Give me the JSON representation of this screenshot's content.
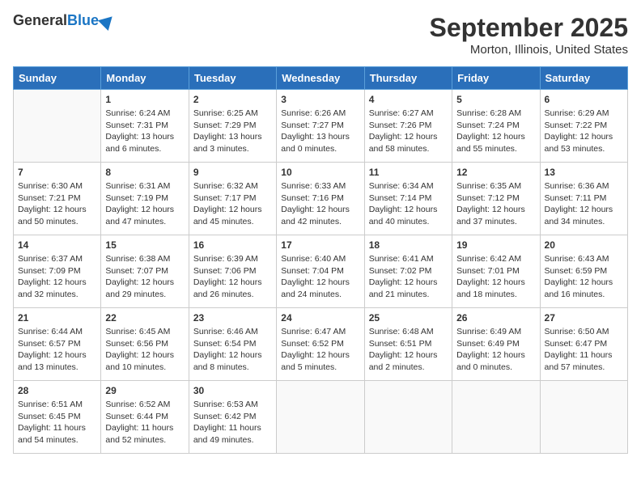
{
  "header": {
    "logo_general": "General",
    "logo_blue": "Blue",
    "month_title": "September 2025",
    "location": "Morton, Illinois, United States"
  },
  "weekdays": [
    "Sunday",
    "Monday",
    "Tuesday",
    "Wednesday",
    "Thursday",
    "Friday",
    "Saturday"
  ],
  "weeks": [
    [
      {
        "day": "",
        "sunrise": "",
        "sunset": "",
        "daylight": ""
      },
      {
        "day": "1",
        "sunrise": "6:24 AM",
        "sunset": "7:31 PM",
        "daylight": "13 hours and 6 minutes."
      },
      {
        "day": "2",
        "sunrise": "6:25 AM",
        "sunset": "7:29 PM",
        "daylight": "13 hours and 3 minutes."
      },
      {
        "day": "3",
        "sunrise": "6:26 AM",
        "sunset": "7:27 PM",
        "daylight": "13 hours and 0 minutes."
      },
      {
        "day": "4",
        "sunrise": "6:27 AM",
        "sunset": "7:26 PM",
        "daylight": "12 hours and 58 minutes."
      },
      {
        "day": "5",
        "sunrise": "6:28 AM",
        "sunset": "7:24 PM",
        "daylight": "12 hours and 55 minutes."
      },
      {
        "day": "6",
        "sunrise": "6:29 AM",
        "sunset": "7:22 PM",
        "daylight": "12 hours and 53 minutes."
      }
    ],
    [
      {
        "day": "7",
        "sunrise": "6:30 AM",
        "sunset": "7:21 PM",
        "daylight": "12 hours and 50 minutes."
      },
      {
        "day": "8",
        "sunrise": "6:31 AM",
        "sunset": "7:19 PM",
        "daylight": "12 hours and 47 minutes."
      },
      {
        "day": "9",
        "sunrise": "6:32 AM",
        "sunset": "7:17 PM",
        "daylight": "12 hours and 45 minutes."
      },
      {
        "day": "10",
        "sunrise": "6:33 AM",
        "sunset": "7:16 PM",
        "daylight": "12 hours and 42 minutes."
      },
      {
        "day": "11",
        "sunrise": "6:34 AM",
        "sunset": "7:14 PM",
        "daylight": "12 hours and 40 minutes."
      },
      {
        "day": "12",
        "sunrise": "6:35 AM",
        "sunset": "7:12 PM",
        "daylight": "12 hours and 37 minutes."
      },
      {
        "day": "13",
        "sunrise": "6:36 AM",
        "sunset": "7:11 PM",
        "daylight": "12 hours and 34 minutes."
      }
    ],
    [
      {
        "day": "14",
        "sunrise": "6:37 AM",
        "sunset": "7:09 PM",
        "daylight": "12 hours and 32 minutes."
      },
      {
        "day": "15",
        "sunrise": "6:38 AM",
        "sunset": "7:07 PM",
        "daylight": "12 hours and 29 minutes."
      },
      {
        "day": "16",
        "sunrise": "6:39 AM",
        "sunset": "7:06 PM",
        "daylight": "12 hours and 26 minutes."
      },
      {
        "day": "17",
        "sunrise": "6:40 AM",
        "sunset": "7:04 PM",
        "daylight": "12 hours and 24 minutes."
      },
      {
        "day": "18",
        "sunrise": "6:41 AM",
        "sunset": "7:02 PM",
        "daylight": "12 hours and 21 minutes."
      },
      {
        "day": "19",
        "sunrise": "6:42 AM",
        "sunset": "7:01 PM",
        "daylight": "12 hours and 18 minutes."
      },
      {
        "day": "20",
        "sunrise": "6:43 AM",
        "sunset": "6:59 PM",
        "daylight": "12 hours and 16 minutes."
      }
    ],
    [
      {
        "day": "21",
        "sunrise": "6:44 AM",
        "sunset": "6:57 PM",
        "daylight": "12 hours and 13 minutes."
      },
      {
        "day": "22",
        "sunrise": "6:45 AM",
        "sunset": "6:56 PM",
        "daylight": "12 hours and 10 minutes."
      },
      {
        "day": "23",
        "sunrise": "6:46 AM",
        "sunset": "6:54 PM",
        "daylight": "12 hours and 8 minutes."
      },
      {
        "day": "24",
        "sunrise": "6:47 AM",
        "sunset": "6:52 PM",
        "daylight": "12 hours and 5 minutes."
      },
      {
        "day": "25",
        "sunrise": "6:48 AM",
        "sunset": "6:51 PM",
        "daylight": "12 hours and 2 minutes."
      },
      {
        "day": "26",
        "sunrise": "6:49 AM",
        "sunset": "6:49 PM",
        "daylight": "12 hours and 0 minutes."
      },
      {
        "day": "27",
        "sunrise": "6:50 AM",
        "sunset": "6:47 PM",
        "daylight": "11 hours and 57 minutes."
      }
    ],
    [
      {
        "day": "28",
        "sunrise": "6:51 AM",
        "sunset": "6:45 PM",
        "daylight": "11 hours and 54 minutes."
      },
      {
        "day": "29",
        "sunrise": "6:52 AM",
        "sunset": "6:44 PM",
        "daylight": "11 hours and 52 minutes."
      },
      {
        "day": "30",
        "sunrise": "6:53 AM",
        "sunset": "6:42 PM",
        "daylight": "11 hours and 49 minutes."
      },
      {
        "day": "",
        "sunrise": "",
        "sunset": "",
        "daylight": ""
      },
      {
        "day": "",
        "sunrise": "",
        "sunset": "",
        "daylight": ""
      },
      {
        "day": "",
        "sunrise": "",
        "sunset": "",
        "daylight": ""
      },
      {
        "day": "",
        "sunrise": "",
        "sunset": "",
        "daylight": ""
      }
    ]
  ],
  "labels": {
    "sunrise": "Sunrise:",
    "sunset": "Sunset:",
    "daylight": "Daylight:"
  }
}
